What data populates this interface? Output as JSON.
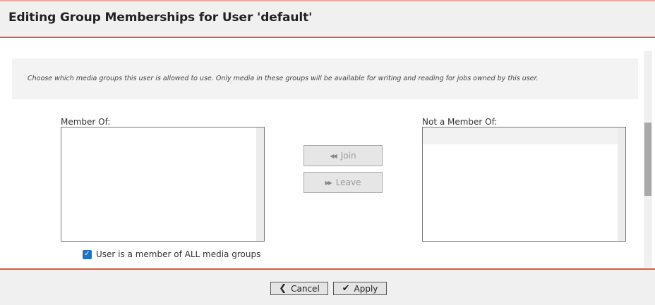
{
  "dialog": {
    "title": "Editing Group Memberships for User 'default'"
  },
  "info": {
    "text": "Choose which media groups this user is allowed to use. Only media in these groups will be available for writing and reading for jobs owned by this user."
  },
  "member_of": {
    "label": "Member Of:",
    "items": []
  },
  "not_member_of": {
    "label": "Not a Member Of:",
    "items": []
  },
  "actions": {
    "join_label": "Join",
    "join_icon": "rewind-icon",
    "leave_label": "Leave",
    "leave_icon": "fast-forward-icon"
  },
  "all_groups": {
    "label": "User is a member of ALL media groups",
    "checked": true
  },
  "footer": {
    "cancel_label": "Cancel",
    "cancel_icon": "chevron-left-icon",
    "apply_label": "Apply",
    "apply_icon": "checkmark-icon"
  },
  "colors": {
    "accent": "#e05a3a",
    "checkbox": "#1a73c8"
  }
}
